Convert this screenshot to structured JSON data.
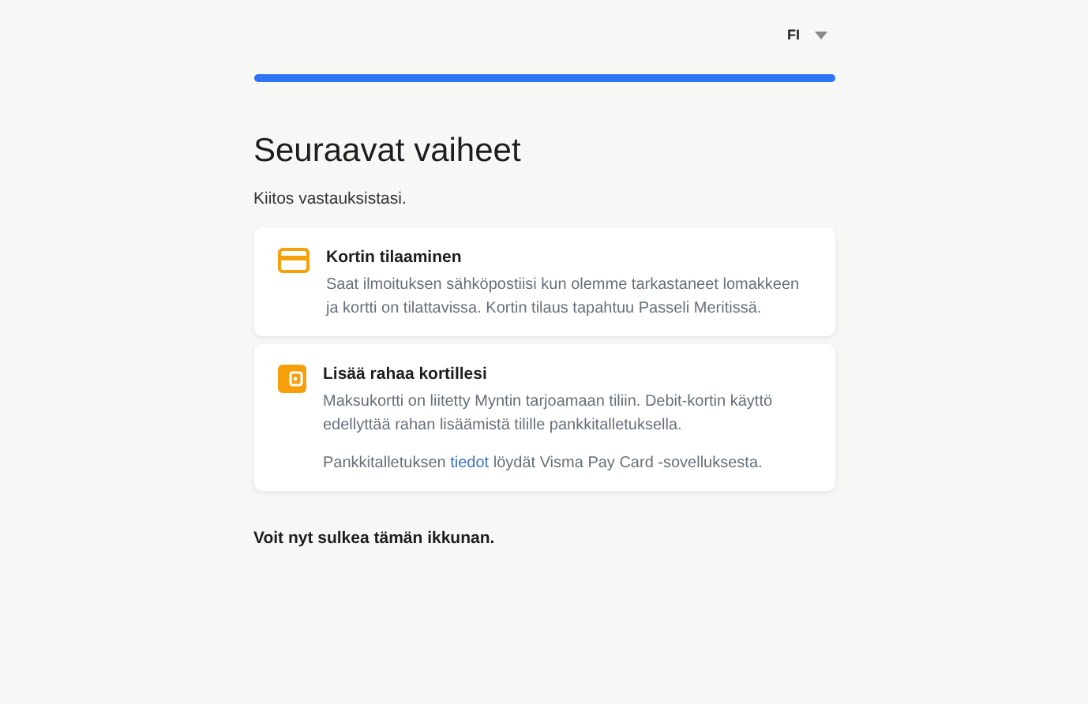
{
  "language": {
    "label": "FI"
  },
  "progress": {
    "level": 1
  },
  "heading": "Seuraavat vaiheet",
  "subtitle": "Kiitos vastauksistasi.",
  "cards": [
    {
      "kind": "card",
      "title": "Kortin tilaaminen",
      "paragraphs": [
        [
          {
            "text": "Saat ilmoituksen sähköpostiisi kun olemme tarkastaneet lomakkeen ja kortti on tilattavissa. Kortin tilaus tapahtuu Passeli Meritissä."
          }
        ]
      ]
    },
    {
      "kind": "wallet",
      "title": "Lisää rahaa kortillesi",
      "paragraphs": [
        [
          {
            "text": "Maksukortti on liitetty Myntin tarjoamaan tiliin. Debit-kortin käyttö edellyttää rahan lisäämistä tilille pankkitalletuksella."
          }
        ],
        [
          {
            "text": "Pankkitalletuksen "
          },
          {
            "text": "tiedot",
            "link": true
          },
          {
            "text": " löydät Visma Pay Card -sovelluksesta."
          }
        ]
      ]
    }
  ],
  "footer": "Voit nyt sulkea tämän ikkunan."
}
